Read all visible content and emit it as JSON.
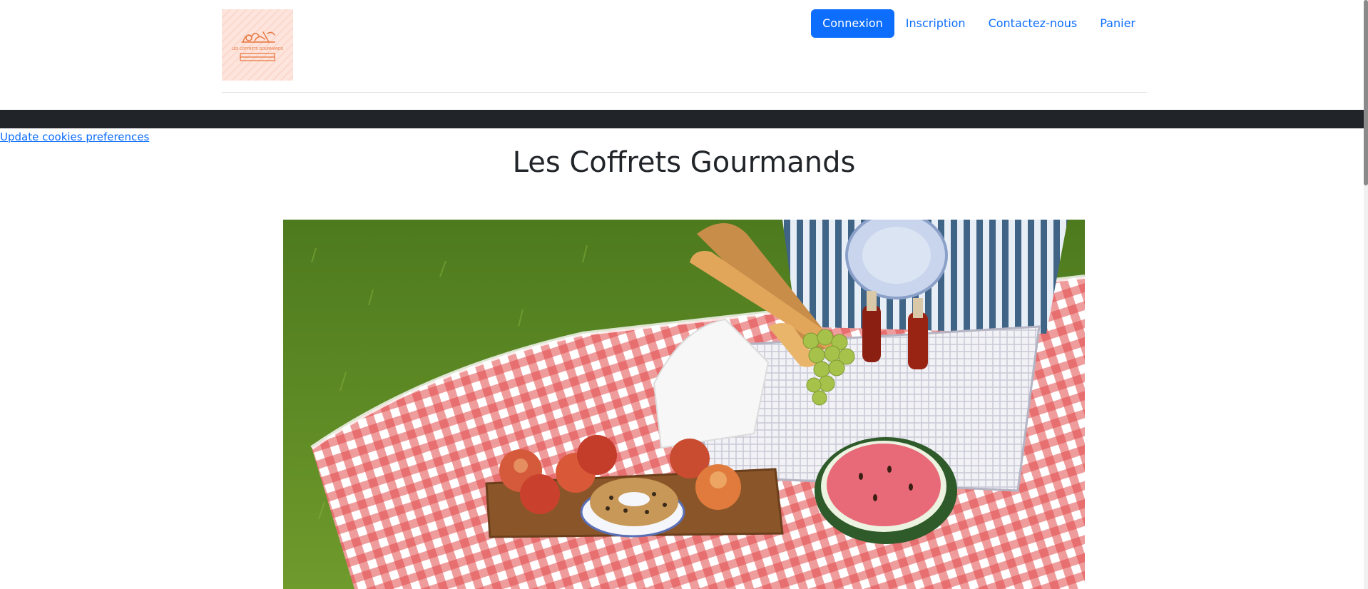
{
  "header": {
    "logo_text": "LES COFFRETS GOURMANDS",
    "nav": {
      "login": "Connexion",
      "signup": "Inscription",
      "contact": "Contactez-nous",
      "cart": "Panier"
    }
  },
  "cookies": {
    "link_label": "Update cookies preferences"
  },
  "main": {
    "title": "Les Coffrets Gourmands",
    "hero_image": "picnic-basket-photo"
  },
  "colors": {
    "primary": "#0d6efd",
    "dark_band": "#212529",
    "logo_bg": "#fde4dc",
    "logo_ink": "#e8743b"
  }
}
